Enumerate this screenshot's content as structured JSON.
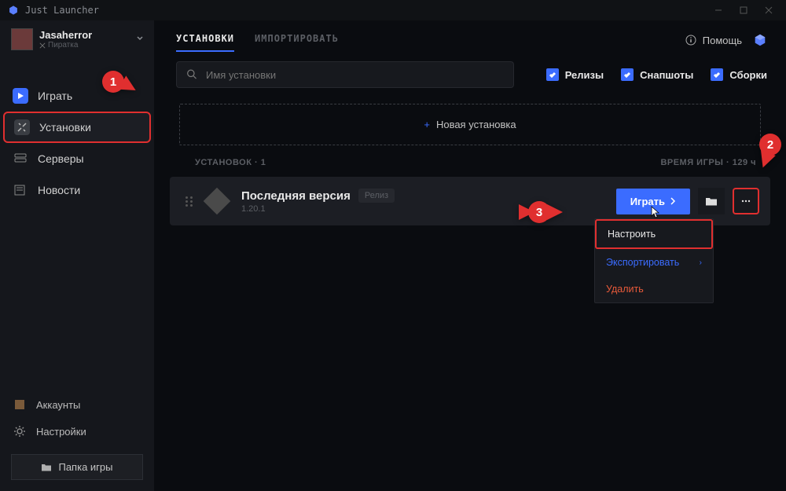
{
  "window": {
    "title": "Just Launcher"
  },
  "user": {
    "name": "Jasaherror",
    "sub": "Пиратка"
  },
  "sidebar": {
    "items": [
      {
        "label": "Играть"
      },
      {
        "label": "Установки"
      },
      {
        "label": "Серверы"
      },
      {
        "label": "Новости"
      }
    ],
    "bottom": {
      "accounts": "Аккаунты",
      "settings": "Настройки",
      "folder": "Папка игры"
    }
  },
  "tabs": {
    "installs": "УСТАНОВКИ",
    "import": "ИМПОРТИРОВАТЬ"
  },
  "help": "Помощь",
  "search": {
    "placeholder": "Имя установки"
  },
  "filters": {
    "releases": "Релизы",
    "snapshots": "Снапшоты",
    "builds": "Сборки"
  },
  "new_install": "Новая установка",
  "counts": {
    "installs": "УСТАНОВОК · 1",
    "playtime": "ВРЕМЯ ИГРЫ · 129 ч"
  },
  "install": {
    "title": "Последняя версия",
    "tag": "Релиз",
    "version": "1.20.1",
    "play": "Играть"
  },
  "menu": {
    "configure": "Настроить",
    "export": "Экспортировать",
    "delete": "Удалить"
  },
  "callouts": {
    "one": "1",
    "two": "2",
    "three": "3"
  }
}
